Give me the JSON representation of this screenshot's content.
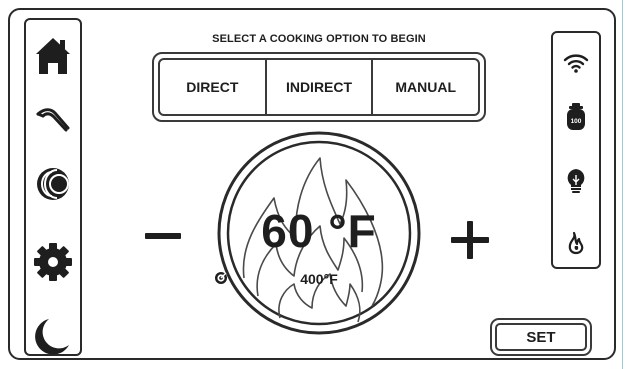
{
  "header": {
    "prompt": "SELECT A COOKING OPTION TO BEGIN"
  },
  "modes": [
    {
      "label": "DIRECT"
    },
    {
      "label": "INDIRECT"
    },
    {
      "label": "MANUAL"
    }
  ],
  "sidebar": {
    "items": [
      {
        "icon": "home-icon"
      },
      {
        "icon": "tongs-icon"
      },
      {
        "icon": "moon-phase-icon"
      },
      {
        "icon": "gear-icon"
      },
      {
        "icon": "night-mode-icon"
      }
    ]
  },
  "dial": {
    "temperature": "60 °F",
    "target": "400°F",
    "target_icon": "target-icon"
  },
  "status": {
    "wifi_icon": "wifi-icon",
    "tank_icon": "propane-tank-icon",
    "tank_level": "100",
    "light_icon": "light-bulb-icon",
    "flame_icon": "flame-icon"
  },
  "controls": {
    "set_label": "SET"
  },
  "colors": {
    "ink": "#1e1e1e",
    "border": "#2a2a2a",
    "edge": "#9ec9d6",
    "background": "#ffffff"
  }
}
